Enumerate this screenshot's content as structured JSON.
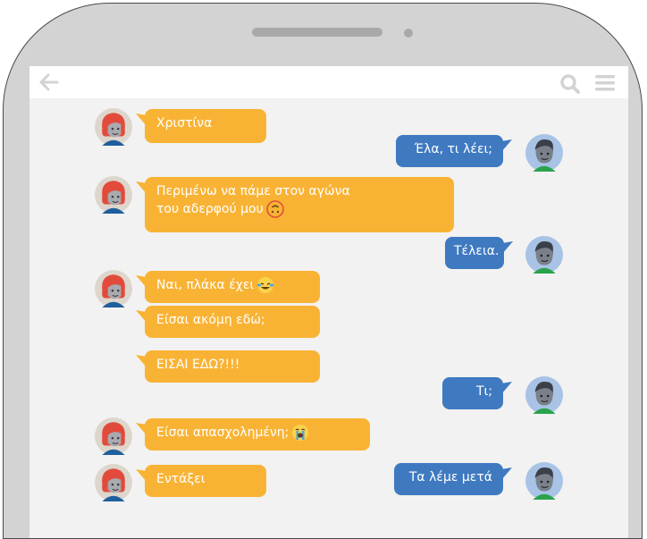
{
  "colors": {
    "incoming_bubble": "#f9b334",
    "outgoing_bubble": "#3f7ac0",
    "chat_background": "#f2f2f2",
    "phone_frame": "#d3d3d3"
  },
  "topbar": {
    "back_icon": "arrow-left-icon",
    "search_icon": "search-icon",
    "menu_icon": "hamburger-menu-icon"
  },
  "messages": [
    {
      "side": "in",
      "text": "Χριστίνα",
      "avatar": true
    },
    {
      "side": "out",
      "text": "Έλα, τι λέει;",
      "avatar": true
    },
    {
      "side": "in",
      "text": "Περιμένω να πάμε στον αγώνα\nτου αδερφού μου",
      "emoji": "upside-down-face-emoji",
      "avatar": true
    },
    {
      "side": "out",
      "text": "Τέλεια.",
      "avatar": true
    },
    {
      "side": "in",
      "text": "Ναι, πλάκα έχει",
      "emoji": "laughing-tears-emoji",
      "avatar": true
    },
    {
      "side": "in",
      "text": "Είσαι ακόμη εδώ;",
      "avatar": false
    },
    {
      "side": "in",
      "text": "ΕΙΣΑΙ ΕΔΩ?!!!",
      "avatar": false
    },
    {
      "side": "out",
      "text": "Τι;",
      "avatar": true
    },
    {
      "side": "in",
      "text": "Είσαι απασχολημένη;",
      "emoji": "crying-face-emoji",
      "avatar": true
    },
    {
      "side": "in",
      "text": "Εντάξει",
      "avatar": true
    },
    {
      "side": "out",
      "text": "Τα λέμε μετά",
      "avatar": true
    }
  ]
}
